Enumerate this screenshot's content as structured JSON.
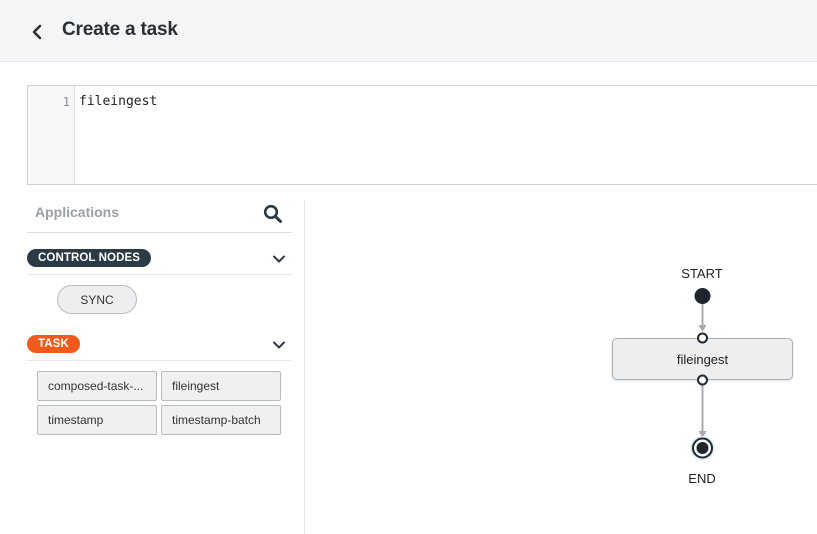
{
  "header": {
    "title": "Create a task",
    "back_icon": "chevron-left-icon"
  },
  "editor": {
    "line_number": "1",
    "code": "fileingest"
  },
  "palette": {
    "title": "Applications",
    "search_icon": "search-icon",
    "groups": [
      {
        "label": "CONTROL NODES",
        "color": "#2b3a44",
        "items": [
          "SYNC"
        ]
      },
      {
        "label": "TASK",
        "color": "#f25a1c",
        "items": [
          "composed-task-...",
          "fileingest",
          "timestamp",
          "timestamp-batch"
        ]
      }
    ]
  },
  "flow": {
    "start_label": "START",
    "task_label": "fileingest",
    "end_label": "END"
  }
}
